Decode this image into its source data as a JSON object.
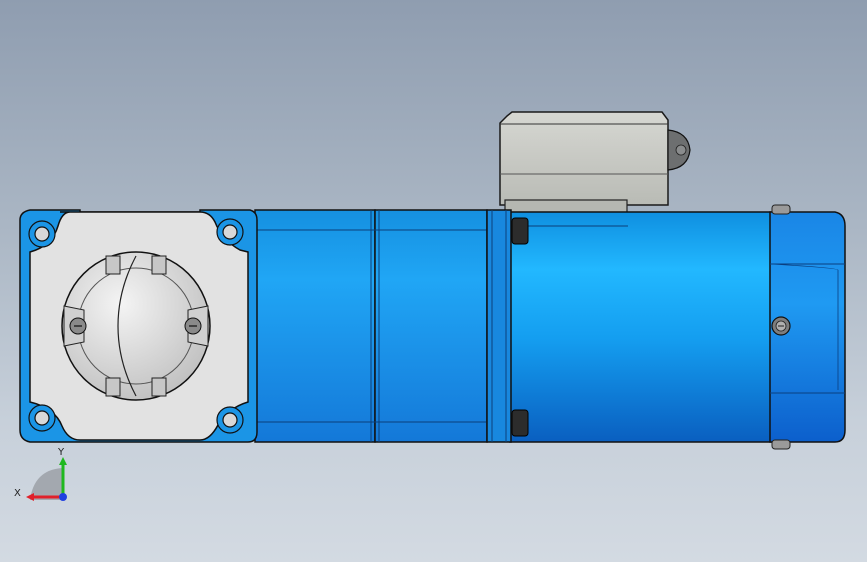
{
  "triad": {
    "x_label": "X",
    "y_label": "Y",
    "x_color": "#e0202a",
    "y_color": "#1fb81f",
    "z_color": "#2040e0"
  },
  "colors": {
    "motor_blue": "#1aa6f0",
    "gearbox_blue": "#1b9be8",
    "flange_gray": "#e2e2e2",
    "terminal_box_gray": "#c9cac5",
    "edge": "#101820"
  },
  "model": {
    "view": "front",
    "parts": [
      "flange",
      "output-shaft",
      "gearbox",
      "motor-body",
      "terminal-box",
      "end-cap"
    ]
  }
}
